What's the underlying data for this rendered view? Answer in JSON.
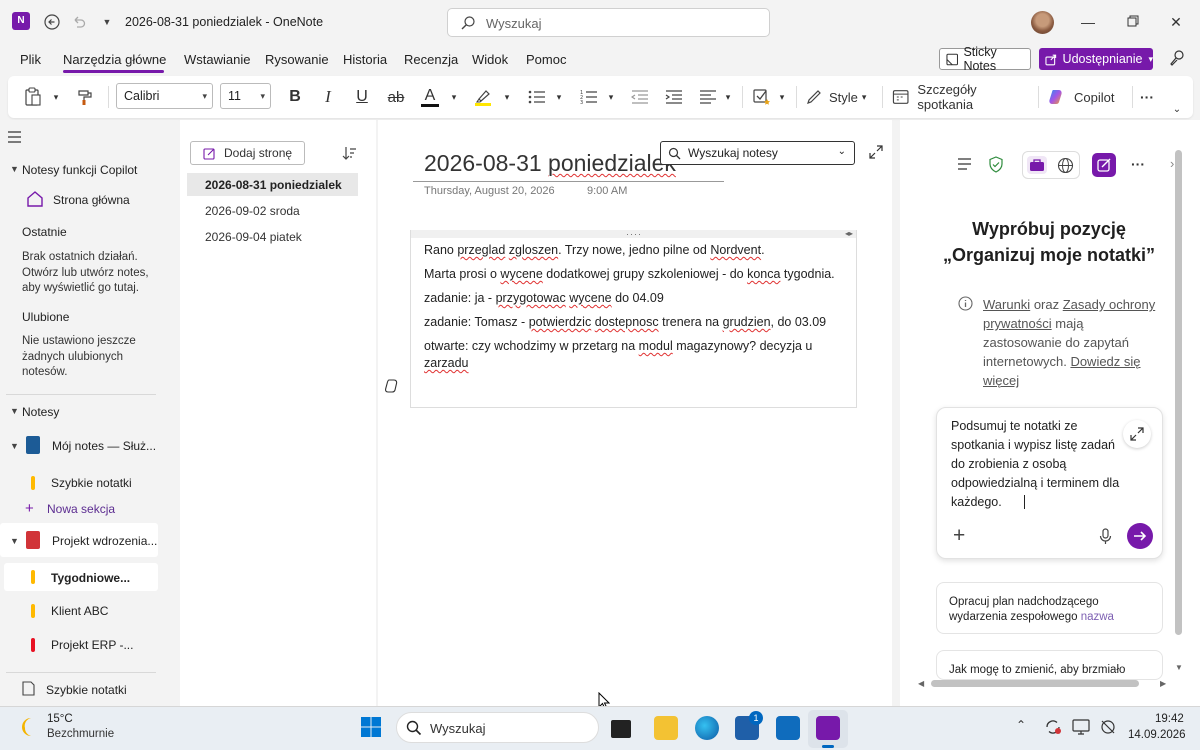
{
  "titlebar": {
    "window_title": "2026-08-31 poniedzialek  -  OneNote",
    "search_placeholder": "Wyszukaj",
    "app_icon_letter": "N"
  },
  "ribbon": {
    "tabs": [
      {
        "label": "Plik"
      },
      {
        "label": "Narzędzia główne"
      },
      {
        "label": "Wstawianie"
      },
      {
        "label": "Rysowanie"
      },
      {
        "label": "Historia"
      },
      {
        "label": "Recenzja"
      },
      {
        "label": "Widok"
      },
      {
        "label": "Pomoc"
      }
    ],
    "sticky_notes": "Sticky Notes",
    "share": "Udostępnianie"
  },
  "toolbar": {
    "font": "Calibri",
    "size": "11",
    "bold": "B",
    "italic": "I",
    "underline": "U",
    "strike": "ab",
    "font_color": "A",
    "style_label": "Style",
    "meeting_details": "Szczegóły spotkania",
    "copilot": "Copilot",
    "more": "···"
  },
  "leftnav": {
    "copilot_notebooks": "Notesy funkcji Copilot",
    "home": "Strona główna",
    "recent_heading": "Ostatnie",
    "recent_empty": "Brak ostatnich działań. Otwórz lub utwórz notes, aby wyświetlić go tutaj.",
    "favorites_heading": "Ulubione",
    "favorites_empty": "Nie ustawiono jeszcze żadnych ulubionych notesów.",
    "notebooks_heading": "Notesy",
    "notebook1": "Mój notes — Służ...",
    "nb1_section1": "Szybkie notatki",
    "new_section": "Nowa sekcja",
    "notebook2": "Projekt wdrozenia...",
    "nb2_sections": [
      "Tygodniowe...",
      "Klient ABC",
      "Projekt ERP -..."
    ],
    "quick_notes_footer": "Szybkie notatki"
  },
  "pagelist": {
    "add_page": "Dodaj stronę",
    "pages": [
      "2026-08-31 poniedzialek",
      "2026-09-02 sroda",
      "2026-09-04 piatek"
    ]
  },
  "page": {
    "title_plain": "2026-08-31 ",
    "title_squig": "poniedzialek",
    "date": "Thursday, August 20, 2026",
    "time": "9:00 AM",
    "notebook_search": "Wyszukaj notesy",
    "lines": [
      {
        "a": "Rano ",
        "b": "przeglad",
        "c": " ",
        "d": "zgloszen",
        "e": ". Trzy nowe, jedno pilne od ",
        "f": "Nordvent",
        "g": "."
      },
      {
        "a": "Marta prosi o ",
        "b": "wycene",
        "c": " dodatkowej grupy szkoleniowej - do ",
        "d": "konca",
        "e": " tygodnia.",
        "f": "",
        "g": ""
      },
      {
        "a": "zadanie: ja - ",
        "b": "przygotowac",
        "c": " ",
        "d": "wycene",
        "e": " do 04.09",
        "f": "",
        "g": ""
      },
      {
        "a": "zadanie: Tomasz - ",
        "b": "potwierdzic",
        "c": " ",
        "d": "dostepnosc",
        "e": " trenera na ",
        "f": "grudzien",
        "g": ", do 03.09"
      },
      {
        "a": "otwarte: czy wchodzimy w przetarg na ",
        "b": "modul",
        "c": " magazynowy? decyzja u ",
        "d": "zarzadu",
        "e": "",
        "f": "",
        "g": ""
      }
    ]
  },
  "copilot": {
    "heading": "Wypróbuj pozycję „Organizuj moje notatki”",
    "terms_link1": "Warunki",
    "terms_and": " oraz ",
    "terms_link2": "Zasady ochrony prywatności",
    "terms_rest": " mają zastosowanie do zapytań internetowych. ",
    "terms_link3": "Dowiedz się więcej",
    "prompt": "Podsumuj te notatki ze spotkania i wypisz listę zadań do zrobienia z osobą odpowiedzialną i terminem dla każdego.",
    "suggestion1_text": "Opracuj plan nadchodzącego wydarzenia zespołowego ",
    "suggestion1_accent": "nazwa",
    "suggestion2_text": "Jak mogę to zmienić, aby brzmiało"
  },
  "taskbar": {
    "temp": "15°C",
    "weather": "Bezchmurnie",
    "search": "Wyszukaj",
    "store_badge": "1",
    "time": "19:42",
    "date": "14.09.2026"
  },
  "colors": {
    "accent": "#7719aa",
    "notebook1": "#1c5b96",
    "notebook2": "#d13438",
    "section_yellow": "#ffb900",
    "section_red": "#e81123"
  }
}
